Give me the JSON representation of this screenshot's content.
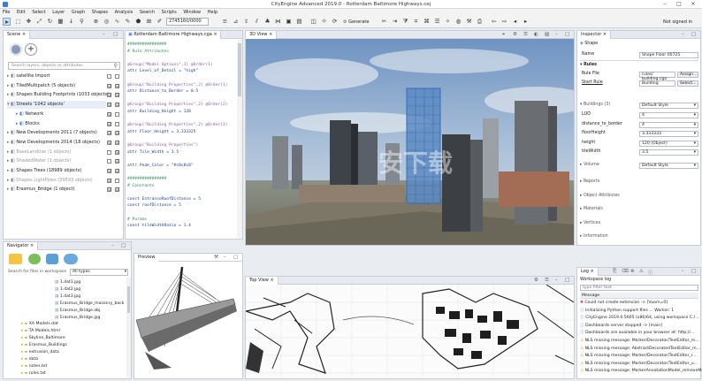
{
  "window": {
    "title": "CityEngine Advanced 2019.0 - Rotterdam Baltimore Highways.cej"
  },
  "menu": [
    "File",
    "Edit",
    "Select",
    "Layer",
    "Graph",
    "Shapes",
    "Analysis",
    "Search",
    "Scripts",
    "Window",
    "Help"
  ],
  "toolbar": {
    "zoom_value": "2745160/0000",
    "generate_label": "Generate",
    "signin_label": "Not signed in"
  },
  "scene": {
    "tab": "Scene",
    "search_placeholder": "Search layers, objects or attributes",
    "layers": [
      {
        "name": "satellite Import",
        "eye": "",
        "lock": ""
      },
      {
        "name": "TiledMultipatch (5 objects)",
        "eye": "☑",
        "lock": "☑"
      },
      {
        "name": "Shapes Building Footprints (1033 objects)",
        "eye": "☑",
        "lock": "☑"
      },
      {
        "name": "Streets '1042 objects'",
        "eye": "☑",
        "lock": "☑"
      },
      {
        "name": "Network",
        "eye": "☑",
        "lock": ""
      },
      {
        "name": "Blocks",
        "eye": "☑",
        "lock": ""
      },
      {
        "name": "New Developments 2011 (7 objects)",
        "eye": "☑",
        "lock": "☑"
      },
      {
        "name": "New Developments 2014 (18 objects)",
        "eye": "☑",
        "lock": "☑"
      },
      {
        "name": "BaseLandUse (1 objects)",
        "eye": "",
        "lock": "☑"
      },
      {
        "name": "ShadedWater (1 objects)",
        "eye": "",
        "lock": "☑"
      },
      {
        "name": "Shapes Trees (18989 objects)",
        "eye": "☑",
        "lock": "☑"
      },
      {
        "name": "Shapes LightPoles (29593 objects)",
        "eye": "☑",
        "lock": ""
      },
      {
        "name": "Erasmus_Bridge (1 object)",
        "eye": "☑",
        "lock": "☑"
      }
    ]
  },
  "editor": {
    "tab": "Rotterdam Baltimore Highways.cga",
    "lines": [
      "################",
      "# Rule Attributes",
      "",
      "@Group(\"Model Options\",1) @Order(1)",
      "attr Level_of_Detail = \"high\"",
      "",
      "@Group(\"Building Properties\",2) @Order(1)",
      "attr Distance_to_Border = 0.5",
      "",
      "@Group(\"Building Properties\",2) @Order(2)",
      "attr Building_Height = 120",
      "",
      "@Group(\"Building Properties\",2) @Order(3)",
      "attr Floor_Height = 3.333325",
      "",
      "@Group(\"Building Properties\")",
      "attr Tile_Width = 3.5",
      "",
      "attr Peak_Color = \"#c8c8c8\"",
      "",
      "################",
      "# Constants",
      "",
      "const EntranceRoofDistance = 5",
      "const roofDistance = 5",
      "",
      "# Params",
      "const tileWidthRatio = 1.4"
    ]
  },
  "view3d": {
    "tab": "3D View",
    "watermark": "安下载"
  },
  "inspector": {
    "tab": "Inspector",
    "shape_type": "Shape",
    "name_label": "Name",
    "name_value": "Shape Floor 00725",
    "rules_header": "Rules",
    "rulefile_label": "Rule File",
    "rulefile_value": "rules/ building.cga",
    "assign_label": "Assign...",
    "startrule_label": "Start Rule",
    "startrule_value": "Building",
    "select_label": "Select...",
    "attr_group": "Buildings (3)",
    "attr_group_value": "Default Style",
    "attrs": [
      {
        "name": "LOD",
        "value": "4"
      },
      {
        "name": "distance_to_border",
        "value": "4"
      },
      {
        "name": "floorHeight",
        "value": "3.333333"
      },
      {
        "name": "height",
        "value": "120 (Object)"
      },
      {
        "name": "tileWidth",
        "value": "3.5"
      }
    ],
    "style_label": "Volume",
    "style_value": "Default Style",
    "sections": [
      "Reports",
      "Object Attributes",
      "Materials",
      "Vertices",
      "Information"
    ]
  },
  "navigator": {
    "tab": "Navigator",
    "search_placeholder": "Search for files in workspace",
    "filter": "All types",
    "items": [
      {
        "name": "1.dat1.jpg",
        "indent": 1
      },
      {
        "name": "1.dat2.jpg",
        "indent": 1
      },
      {
        "name": "1.dat3.jpg",
        "indent": 1
      },
      {
        "name": "Erasmus_Bridge_masonry_back",
        "indent": 1
      },
      {
        "name": "Erasmus_Bridge.obj",
        "indent": 1
      },
      {
        "name": "Erasmus_Bridge.jpg",
        "indent": 1
      },
      {
        "name": "XA Models.dat",
        "indent": 0
      },
      {
        "name": "TA Models.html",
        "indent": 0
      },
      {
        "name": "Skyline_Baltimore",
        "indent": 0
      },
      {
        "name": "Erasmus_Buildings",
        "indent": 0
      },
      {
        "name": "extrusion_data",
        "indent": 0
      },
      {
        "name": "data",
        "indent": 0
      },
      {
        "name": "notes.txt",
        "indent": 0
      },
      {
        "name": "rules.txt",
        "indent": 0
      }
    ]
  },
  "preview": {
    "tab": "Preview"
  },
  "topview": {
    "tab": "Top View"
  },
  "log": {
    "tab": "Log",
    "workspace_label": "Workspace log",
    "filter_placeholder": "type filter text",
    "column": "Message",
    "rows": [
      {
        "icon": "err",
        "text": "Could not create extension -> [Vuom=0]"
      },
      {
        "icon": "info",
        "text": "Initializing Python support files ... Worker: 1"
      },
      {
        "icon": "info",
        "text": "CityEngine 2019.0.5605 (x86)64, using workspace C:/..."
      },
      {
        "icon": "info",
        "text": "Dashboards server stopped -> [main]"
      },
      {
        "icon": "info",
        "text": "Dashboards are available in your browser at: http://..."
      },
      {
        "icon": "warn",
        "text": "NLS missing message: Marker/Decorator/TextEditor_m..."
      },
      {
        "icon": "warn",
        "text": "NLS missing message: AbstractDecoratedTextEditor_m..."
      },
      {
        "icon": "warn",
        "text": "NLS missing message: Marker/Decorator/TextEditor_r..."
      },
      {
        "icon": "warn",
        "text": "NLS missing message: Marker/Decorator/TextEditor_u..."
      },
      {
        "icon": "warn",
        "text": "NLS missing message: MarkerAnnotationModel_removeMa..."
      }
    ]
  },
  "colors": {
    "accent": "#3d7bd8",
    "selection": "#cfe0f7"
  }
}
